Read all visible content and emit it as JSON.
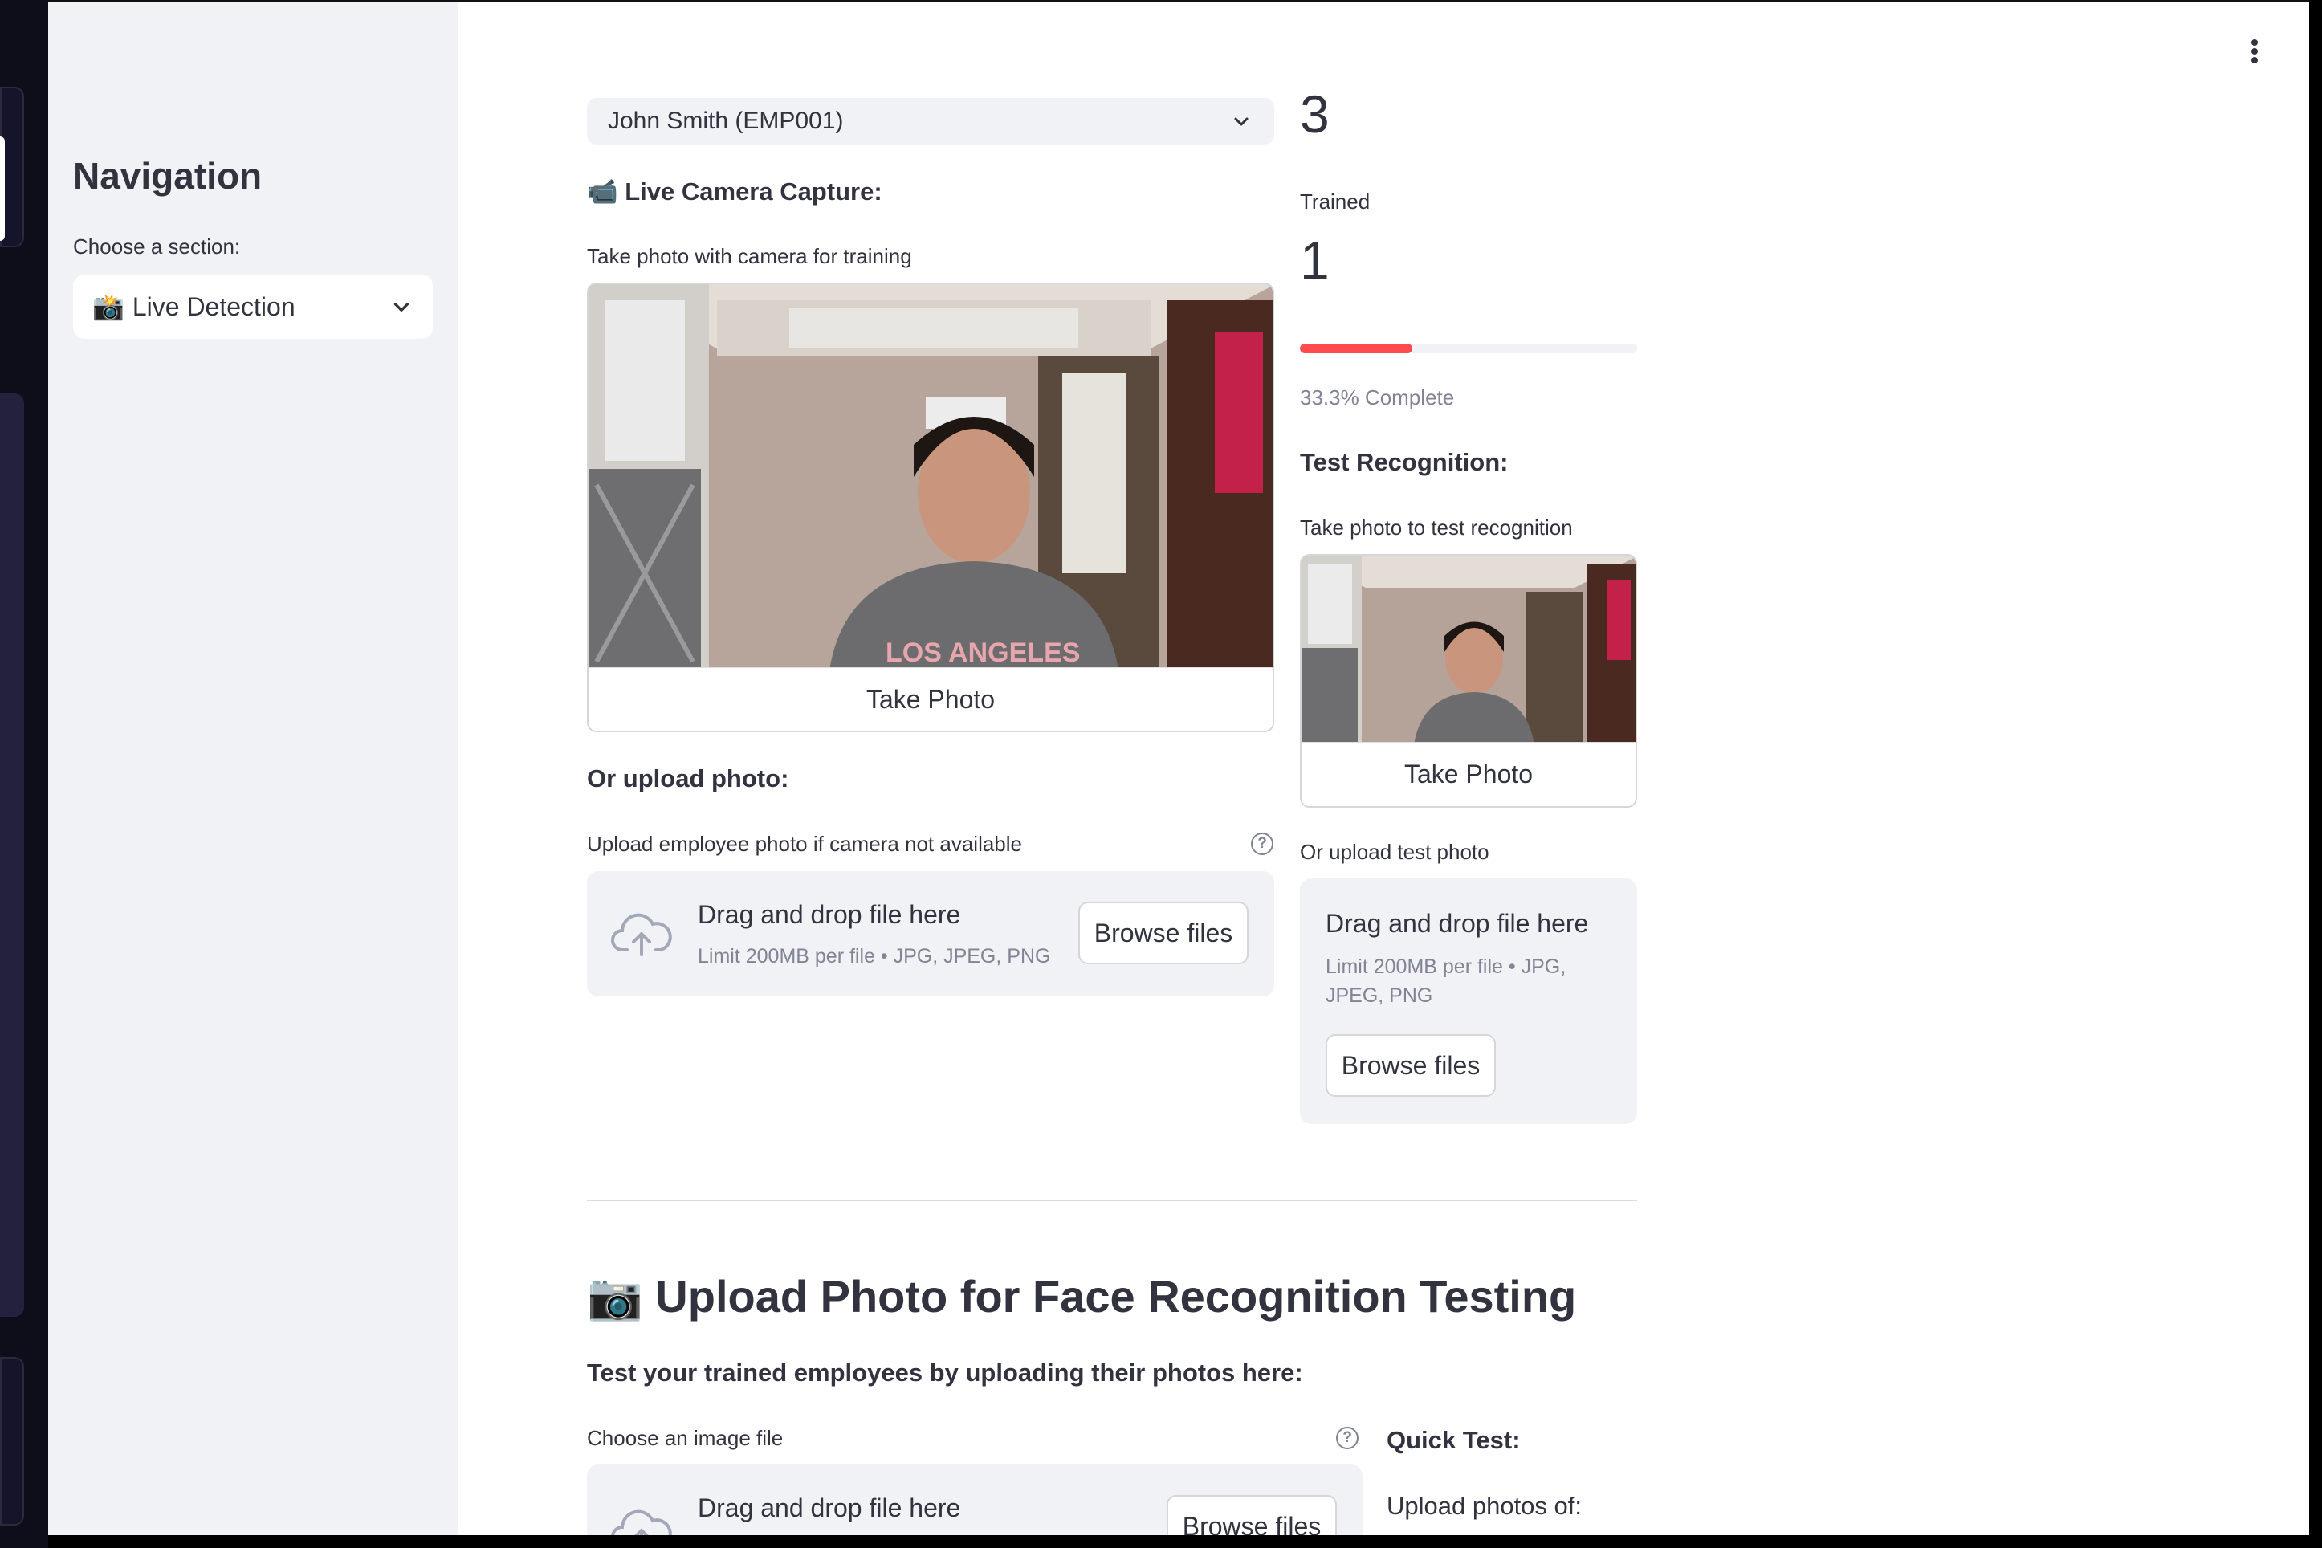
{
  "sidebar": {
    "title": "Navigation",
    "choose_label": "Choose a section:",
    "section_select": {
      "icon": "📸",
      "value": "Live Detection"
    }
  },
  "employee_select": {
    "value": "John Smith (EMP001)"
  },
  "stats": {
    "total_value": "3",
    "trained_label": "Trained",
    "trained_value": "1",
    "progress_fraction": 0.333,
    "progress_text": "33.3% Complete"
  },
  "live_capture": {
    "icon": "📹",
    "heading": "Live Camera Capture:",
    "camera_label": "Take photo with camera for training",
    "take_photo": "Take Photo"
  },
  "upload_photo": {
    "heading": "Or upload photo:",
    "label": "Upload employee photo if camera not available",
    "help": "?",
    "dropzone": {
      "title": "Drag and drop file here",
      "limit": "Limit 200MB per file • JPG, JPEG, PNG",
      "browse": "Browse files"
    }
  },
  "test_recognition": {
    "heading": "Test Recognition:",
    "camera_label": "Take photo to test recognition",
    "take_photo": "Take Photo",
    "upload_label": "Or upload test photo",
    "dropzone": {
      "title": "Drag and drop file here",
      "limit_line1": "Limit 200MB per file • JPG,",
      "limit_line2": "JPEG, PNG",
      "browse": "Browse files"
    }
  },
  "face_testing": {
    "icon": "📷",
    "heading": "Upload Photo for Face Recognition Testing",
    "subheading": "Test your trained employees by uploading their photos here:",
    "file_label": "Choose an image file",
    "help": "?",
    "dropzone": {
      "title": "Drag and drop file here",
      "browse": "Browse files"
    },
    "quick_test": "Quick Test:",
    "upload_photos_of": "Upload photos of:"
  },
  "colors": {
    "accent": "#ff4b4b",
    "sidebar_bg": "#f0f2f6",
    "text": "#31333f",
    "muted": "#808495"
  }
}
